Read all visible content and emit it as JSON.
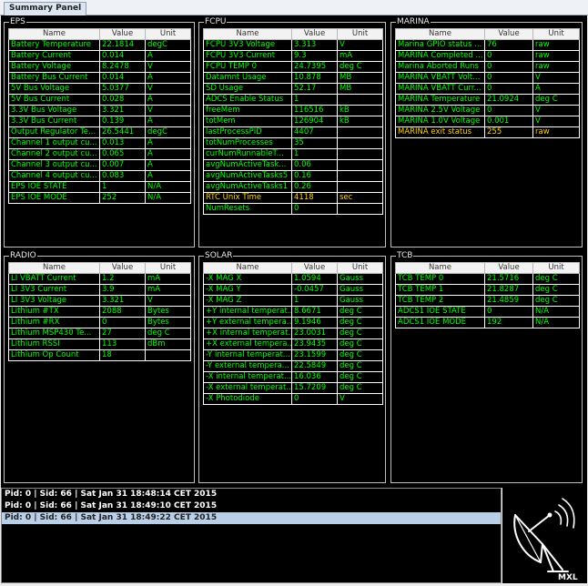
{
  "tab": "Summary Panel",
  "columns": {
    "name": "Name",
    "value": "Value",
    "unit": "Unit"
  },
  "panels": {
    "eps": {
      "title": "EPS",
      "rows": [
        {
          "name": "Battery Temperature",
          "value": "22.1814",
          "unit": "degC"
        },
        {
          "name": "Battery Current",
          "value": "0.014",
          "unit": "A"
        },
        {
          "name": "Battery Voltage",
          "value": "8.2478",
          "unit": "V"
        },
        {
          "name": "Battery Bus Current",
          "value": "0.014",
          "unit": "A"
        },
        {
          "name": "5V Bus Voltage",
          "value": "5.0377",
          "unit": "V"
        },
        {
          "name": "5V Bus Current",
          "value": "0.028",
          "unit": "A"
        },
        {
          "name": "3.3V Bus Voltage",
          "value": "3.321",
          "unit": "V"
        },
        {
          "name": "3.3V Bus Current",
          "value": "0.139",
          "unit": "A"
        },
        {
          "name": "Output Regulator Te...",
          "value": "26.5441",
          "unit": "degC"
        },
        {
          "name": "Channel 1 output cu...",
          "value": "0.013",
          "unit": "A"
        },
        {
          "name": "Channel 2 output cu...",
          "value": "0.065",
          "unit": "A"
        },
        {
          "name": "Channel 3 output cu...",
          "value": "0.007",
          "unit": "A"
        },
        {
          "name": "Channel 4 output cu...",
          "value": "0.083",
          "unit": "A"
        },
        {
          "name": "EPS IOE STATE",
          "value": "1",
          "unit": "N/A"
        },
        {
          "name": "EPS IOE MODE",
          "value": "252",
          "unit": "N/A"
        }
      ]
    },
    "fcpu": {
      "title": "FCPU",
      "rows": [
        {
          "name": "FCPU 3V3 Voltage",
          "value": "3.313",
          "unit": "V"
        },
        {
          "name": "FCPU 3V3 Current",
          "value": "9.3",
          "unit": "mA"
        },
        {
          "name": "FCPU TEMP 0",
          "value": "24.7395",
          "unit": "deg C"
        },
        {
          "name": "Datamnt Usage",
          "value": "10.878",
          "unit": "MB"
        },
        {
          "name": "SD Usage",
          "value": "52.17",
          "unit": "MB"
        },
        {
          "name": "ADCS Enable Status",
          "value": "1",
          "unit": ""
        },
        {
          "name": "freeMem",
          "value": "116516",
          "unit": "kB"
        },
        {
          "name": "totMem",
          "value": "126904",
          "unit": "kB"
        },
        {
          "name": "lastProcessPID",
          "value": "4407",
          "unit": ""
        },
        {
          "name": "totNumProcesses",
          "value": "35",
          "unit": ""
        },
        {
          "name": "curNumRunnableT...",
          "value": "1",
          "unit": ""
        },
        {
          "name": "avgNumActiveTask...",
          "value": "0.06",
          "unit": ""
        },
        {
          "name": "avgNumActiveTasks5",
          "value": "0.16",
          "unit": ""
        },
        {
          "name": "avgNumActiveTasks1",
          "value": "0.26",
          "unit": ""
        },
        {
          "name": "RTC Unix Time",
          "value": "4118",
          "unit": "sec",
          "warn": true
        },
        {
          "name": "NumResets",
          "value": "0",
          "unit": ""
        }
      ]
    },
    "marina": {
      "title": "MARINA",
      "rows": [
        {
          "name": "Marina GPIO status ...",
          "value": "76",
          "unit": "raw"
        },
        {
          "name": "MARINA Completed ...",
          "value": "0",
          "unit": "raw"
        },
        {
          "name": "Marina Aborted Runs",
          "value": "0",
          "unit": "raw"
        },
        {
          "name": "MARINA VBATT Volt...",
          "value": "0",
          "unit": "V"
        },
        {
          "name": "MARINA VBATT Curr...",
          "value": "0",
          "unit": "A"
        },
        {
          "name": "MARINA Temperature",
          "value": "21.0924",
          "unit": "deg C"
        },
        {
          "name": "MARINA 2.5V Voltage",
          "value": "0",
          "unit": "V"
        },
        {
          "name": "MARINA 1.0V Voltage",
          "value": "0.001",
          "unit": "V"
        },
        {
          "name": "MARINA exit status",
          "value": "255",
          "unit": "raw",
          "warn": true
        }
      ]
    },
    "radio": {
      "title": "RADIO",
      "rows": [
        {
          "name": "LI VBATT Current",
          "value": "1.2",
          "unit": "mA"
        },
        {
          "name": "LI 3V3 Current",
          "value": "3.9",
          "unit": "mA"
        },
        {
          "name": "LI 3V3 Voltage",
          "value": "3.321",
          "unit": "V"
        },
        {
          "name": "Lithium #TX",
          "value": "2088",
          "unit": "Bytes"
        },
        {
          "name": "Lithium #RX",
          "value": "0",
          "unit": "Bytes"
        },
        {
          "name": "Lithium MSP430 Te...",
          "value": "27",
          "unit": "deg C"
        },
        {
          "name": "Lithium RSSI",
          "value": "113",
          "unit": "dBm"
        },
        {
          "name": "Lithium Op Count",
          "value": "18",
          "unit": ""
        }
      ]
    },
    "solar": {
      "title": "SOLAR",
      "rows": [
        {
          "name": "-X MAG X",
          "value": "1.0594",
          "unit": "Gauss"
        },
        {
          "name": "-X MAG Y",
          "value": "-0.0457",
          "unit": "Gauss"
        },
        {
          "name": "-X MAG Z",
          "value": "1",
          "unit": "Gauss"
        },
        {
          "name": "+Y internal temperat...",
          "value": "8.6671",
          "unit": "deg C"
        },
        {
          "name": "+Y external tempera...",
          "value": "9.1946",
          "unit": "deg C"
        },
        {
          "name": "+X internal temperat...",
          "value": "23.0031",
          "unit": "deg C"
        },
        {
          "name": "+X external tempera...",
          "value": "23.9435",
          "unit": "deg C"
        },
        {
          "name": "-Y internal temperat...",
          "value": "23.1599",
          "unit": "deg C"
        },
        {
          "name": "-Y external tempera...",
          "value": "22.5849",
          "unit": "deg C"
        },
        {
          "name": "-X internal temperat...",
          "value": "16.036",
          "unit": "deg C"
        },
        {
          "name": "-X external temperat...",
          "value": "15.7209",
          "unit": "deg C"
        },
        {
          "name": "-X Photodiode",
          "value": "0",
          "unit": "V"
        }
      ]
    },
    "tcb": {
      "title": "TCB",
      "rows": [
        {
          "name": "TCB TEMP 0",
          "value": "21.5716",
          "unit": "deg C"
        },
        {
          "name": "TCB TEMP 1",
          "value": "21.8287",
          "unit": "deg C"
        },
        {
          "name": "TCB TEMP 2",
          "value": "21.4859",
          "unit": "deg C"
        },
        {
          "name": "ADCS1 IOE STATE",
          "value": "0",
          "unit": "N/A"
        },
        {
          "name": "ADCS1 IOE MODE",
          "value": "192",
          "unit": "N/A"
        }
      ]
    }
  },
  "log": [
    {
      "text": "Pid: 0 | Sid: 66 | Sat Jan 31 18:48:14 CET 2015",
      "selected": false
    },
    {
      "text": "Pid: 0 | Sid: 66 | Sat Jan 31 18:49:10 CET 2015",
      "selected": false
    },
    {
      "text": "Pid: 0 | Sid: 66 | Sat Jan 31 18:49:22 CET 2015",
      "selected": true
    }
  ],
  "logo": {
    "text": "MXL",
    "icon": "satellite-dish-icon"
  }
}
